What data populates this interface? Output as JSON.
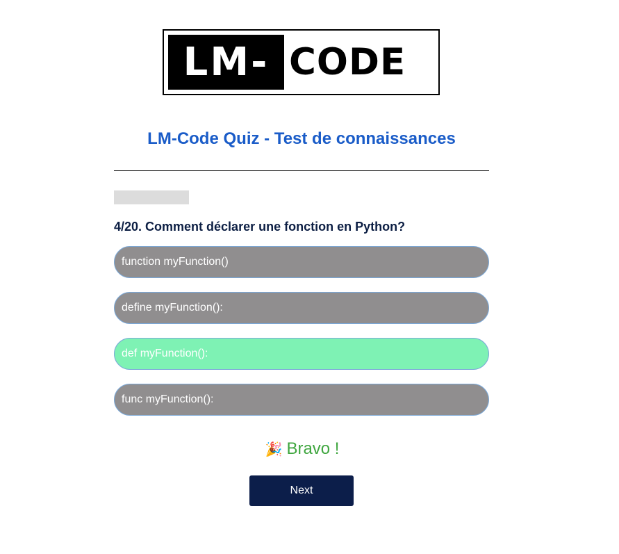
{
  "logo": {
    "left_text": "LM-",
    "right_text": "CODE"
  },
  "quiz": {
    "title": "LM-Code Quiz - Test de connaissances",
    "progress": 0.2,
    "question": "4/20. Comment déclarer une fonction en Python?",
    "answers": [
      {
        "label": "function myFunction()",
        "state": "neutral"
      },
      {
        "label": "define myFunction():",
        "state": "neutral"
      },
      {
        "label": "def myFunction():",
        "state": "correct"
      },
      {
        "label": "func myFunction():",
        "state": "neutral"
      }
    ],
    "feedback": {
      "emoji": "🎉",
      "text": "Bravo !"
    },
    "next_label": "Next"
  },
  "colors": {
    "title": "#1a5cc8",
    "answer_neutral": "#908e8f",
    "answer_correct": "#7ef2b4",
    "feedback": "#3fa63f",
    "next_button": "#0c1e4a"
  }
}
